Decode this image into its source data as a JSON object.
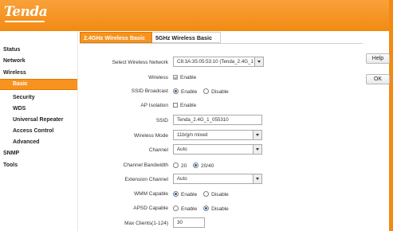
{
  "brand": {
    "logo_text": "Tenda"
  },
  "sidebar": {
    "items": [
      {
        "label": "Status"
      },
      {
        "label": "Network"
      },
      {
        "label": "Wireless"
      },
      {
        "label": "SNMP"
      },
      {
        "label": "Tools"
      }
    ],
    "wireless_sub": [
      {
        "label": "Basic",
        "active": true
      },
      {
        "label": "Security"
      },
      {
        "label": "WDS"
      },
      {
        "label": "Universal Repeater"
      },
      {
        "label": "Access Control"
      },
      {
        "label": "Advanced"
      }
    ]
  },
  "tabs": [
    {
      "label": "2.4GHz Wireless Basic",
      "active": true
    },
    {
      "label": "5GHz Wireless Basic",
      "active": false
    }
  ],
  "form": {
    "select_network": {
      "label": "Select Wireless Network",
      "value": "C8:3A:35:05:53:10  (Tenda_2.4G_1"
    },
    "wireless": {
      "label": "Wireless",
      "option": "Enable",
      "checked": true
    },
    "ssid_broadcast": {
      "label": "SSID Broadcast",
      "options": [
        "Enable",
        "Disable"
      ],
      "selected": "Enable"
    },
    "ap_isolation": {
      "label": "AP Isolation",
      "option": "Enable",
      "checked": false
    },
    "ssid": {
      "label": "SSID",
      "value": "Tenda_2.4G_1_055310"
    },
    "wireless_mode": {
      "label": "Wireless Mode",
      "value": "11b/g/n mixed"
    },
    "channel": {
      "label": "Channel",
      "value": "Auto"
    },
    "channel_bandwidth": {
      "label": "Channel Bandwidth",
      "options": [
        "20",
        "20/40"
      ],
      "selected": "20/40"
    },
    "extension_channel": {
      "label": "Extension Channel",
      "value": "Auto"
    },
    "wmm_capable": {
      "label": "WMM Capable",
      "options": [
        "Enable",
        "Disable"
      ],
      "selected": "Enable"
    },
    "apsd_capable": {
      "label": "APSD Capable",
      "options": [
        "Enable",
        "Disable"
      ],
      "selected": "Disable"
    },
    "max_clients": {
      "label": "Max Clients(1-124)",
      "value": "30"
    }
  },
  "buttons": {
    "help": "Help",
    "ok": "OK"
  },
  "colors": {
    "accent": "#f7931e",
    "radio_dot": "#1d5ea8"
  }
}
